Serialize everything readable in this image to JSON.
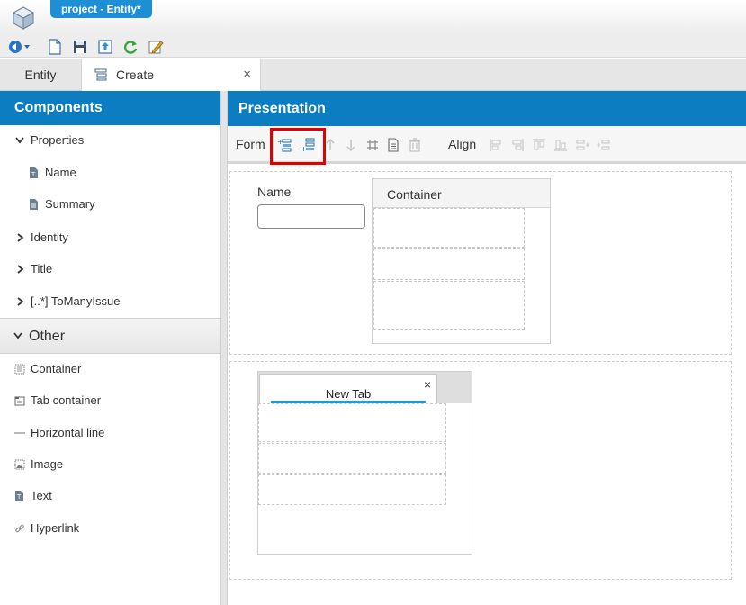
{
  "window": {
    "title": "project - Entity*"
  },
  "toolbar": {
    "icons": [
      "back-dropdown-icon",
      "new-file-icon",
      "save-icon",
      "export-icon",
      "refresh-icon",
      "edit-icon"
    ]
  },
  "tabs": [
    {
      "label": "Entity",
      "active": false
    },
    {
      "label": "Create",
      "active": true,
      "closable": true,
      "close_glyph": "×"
    }
  ],
  "components_panel": {
    "title": "Components",
    "properties_section": {
      "label": "Properties",
      "expanded": true,
      "items": [
        {
          "label": "Name",
          "icon": "text-field-icon"
        },
        {
          "label": "Summary",
          "icon": "text-area-icon"
        }
      ]
    },
    "collapsed_sections": [
      {
        "label": "Identity"
      },
      {
        "label": "Title"
      },
      {
        "label": "[..*] ToManyIssue"
      }
    ],
    "other_section": {
      "label": "Other",
      "expanded": true,
      "items": [
        {
          "label": "Container",
          "icon": "container-icon"
        },
        {
          "label": "Tab container",
          "icon": "tab-container-icon"
        },
        {
          "label": "Horizontal line",
          "icon": "horizontal-line-icon"
        },
        {
          "label": "Image",
          "icon": "image-icon"
        },
        {
          "label": "Text",
          "icon": "text-icon"
        },
        {
          "label": "Hyperlink",
          "icon": "hyperlink-icon"
        }
      ]
    }
  },
  "presentation_panel": {
    "title": "Presentation",
    "toolbar": {
      "form_label": "Form",
      "align_label": "Align",
      "form_icons": [
        "add-row-before-icon",
        "add-row-after-icon",
        "move-up-icon",
        "move-down-icon",
        "grid-icon",
        "properties-icon",
        "delete-icon"
      ],
      "align_icons": [
        "align-left-icon",
        "align-right-icon",
        "align-top-icon",
        "align-bottom-icon",
        "distribute-horizontal-icon",
        "distribute-vertical-icon"
      ],
      "highlight_color": "#e00000"
    },
    "form": {
      "name_field_label": "Name",
      "name_field_value": "",
      "container_title": "Container",
      "tab_container": {
        "tab_label": "New Tab",
        "close_glyph": "×"
      }
    }
  },
  "colors": {
    "header_blue": "#0d7dc1",
    "title_tab_blue": "#1e8fd5",
    "tab_underline": "#1e98d7"
  }
}
